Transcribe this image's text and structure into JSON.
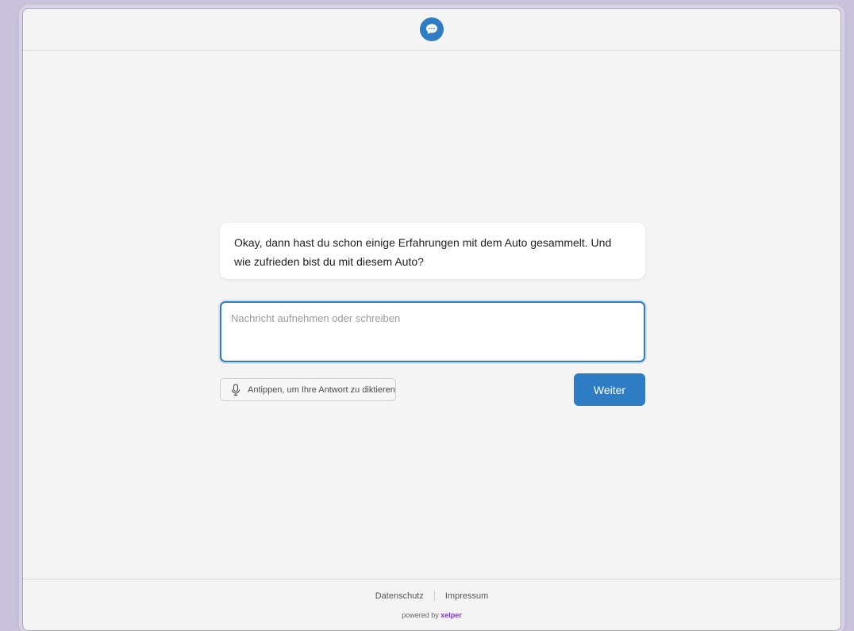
{
  "header": {
    "logo_icon": "chat-bubble-icon",
    "accent_color": "#2e7cc4"
  },
  "chat": {
    "message": "Okay, dann hast du schon einige Erfahrungen mit dem Auto gesammelt. Und wie zufrieden bist du mit diesem Auto?"
  },
  "input": {
    "value": "",
    "placeholder": "Nachricht aufnehmen oder schreiben"
  },
  "actions": {
    "dictate_icon": "microphone-icon",
    "dictate_label": "Antippen, um Ihre Antwort zu diktieren",
    "continue_label": "Weiter"
  },
  "footer": {
    "privacy_label": "Datenschutz",
    "imprint_label": "Impressum",
    "powered_prefix": "powered by",
    "powered_brand": "xelper",
    "brand_color": "#7a3bd1"
  }
}
